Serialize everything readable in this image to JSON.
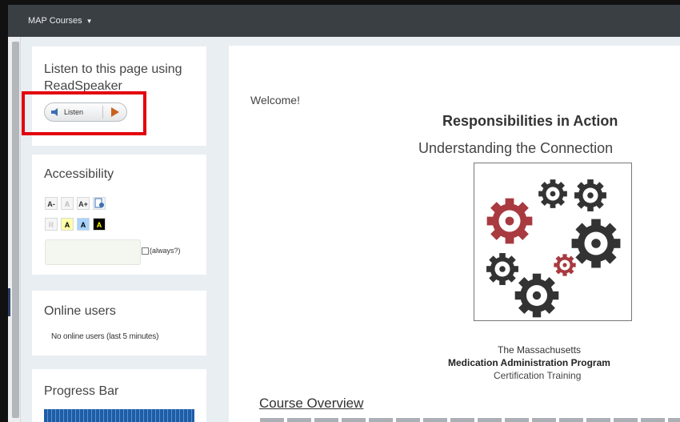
{
  "topbar": {
    "menu_label": "MAP Courses",
    "menu_caret": "▼"
  },
  "readspeaker": {
    "title": "Listen to this page using ReadSpeaker",
    "listen_label": "Listen",
    "highlight_color": "#e3000f"
  },
  "accessibility": {
    "title": "Accessibility",
    "row1": [
      {
        "label": "A-",
        "bg": "#f5f5f5",
        "fg": "#333333"
      },
      {
        "label": "A",
        "bg": "#f5f5f5",
        "fg": "#bbbbbb"
      },
      {
        "label": "A+",
        "bg": "#f5f5f5",
        "fg": "#333333"
      },
      {
        "icon": "readability-icon"
      }
    ],
    "row2": [
      {
        "label": "R",
        "bg": "#f5f5f5",
        "fg": "#cccccc"
      },
      {
        "label": "A",
        "bg": "#ffffa6",
        "fg": "#000000"
      },
      {
        "label": "A",
        "bg": "#a6d3ff",
        "fg": "#000000"
      },
      {
        "label": "A",
        "bg": "#000000",
        "fg": "#ffff00"
      }
    ],
    "always_label": "(always?)"
  },
  "online_users": {
    "title": "Online users",
    "text": "No online users (last 5 minutes)"
  },
  "progress_bar": {
    "title": "Progress Bar"
  },
  "main": {
    "welcome": "Welcome!",
    "title": "Responsibilities in Action",
    "subtitle": "Understanding the Connection",
    "caption_line1": "The Massachusetts",
    "caption_line2": "Medication Administration Program",
    "caption_line3": "Certification Training",
    "course_overview": "Course Overview"
  },
  "colors": {
    "topbar": "#3a3f44",
    "gear_red": "#a83a40",
    "gear_dark": "#333333",
    "progress_blue": "#1e5ea8"
  }
}
